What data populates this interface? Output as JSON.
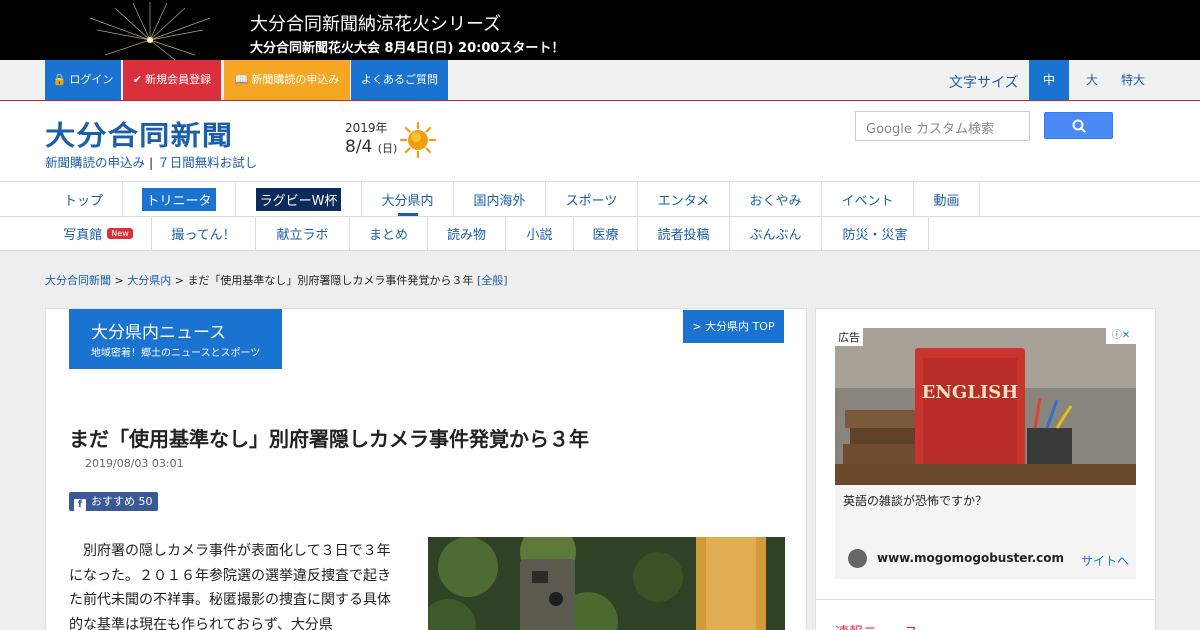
{
  "banner": {
    "title": "大分合同新聞納涼花火シリーズ",
    "subtitle": "大分合同新聞花火大会 8月4日(日) 20:00スタート！"
  },
  "member_bar": {
    "login": "ログイン",
    "register": "新規会員登録",
    "subscribe": "新聞購読の申込み",
    "faq": "よくあるご質問",
    "font_size_label": "文字サイズ",
    "font_sizes": [
      "中",
      "大",
      "特大"
    ],
    "active_font_size": "中",
    "colors": {
      "login": "#1a73d1",
      "register": "#d9303b",
      "subscribe": "#f5a623",
      "faq": "#1a73d1"
    }
  },
  "header": {
    "logo": "大分合同新聞",
    "sub_link1": "新聞購読の申込み",
    "sub_link2": "７日間無料お試し",
    "year": "2019年",
    "date": "8/4",
    "weekday": "(日)",
    "weather_icon": "sun-icon",
    "search_placeholder": "Google カスタム検索"
  },
  "nav_primary": [
    "トップ",
    "トリニータ",
    "ラグビーW杯",
    "大分県内",
    "国内海外",
    "スポーツ",
    "エンタメ",
    "おくやみ",
    "イベント",
    "動画"
  ],
  "nav_secondary": [
    "写真館",
    "撮ってん！",
    "献立ラボ",
    "まとめ",
    "読み物",
    "小説",
    "医療",
    "読者投稿",
    "ぶんぶん",
    "防災・災害"
  ],
  "nav_new_badge": "New",
  "breadcrumb": {
    "home": "大分合同新聞",
    "section": "大分県内",
    "current": "まだ「使用基準なし」別府署隠しカメラ事件発覚から３年",
    "full": "[全般]"
  },
  "section": {
    "title": "大分県内ニュース",
    "tagline": "地域密着！郷土のニュースとスポーツ",
    "top_link": "> 大分県内 TOP"
  },
  "article": {
    "title": "まだ「使用基準なし」別府署隠しカメラ事件発覚から３年",
    "date": "2019/08/03 03:01",
    "recommend_label": "おすすめ",
    "recommend_count": "50",
    "body": "　別府署の隠しカメラ事件が表面化して３日で３年になった。２０１６年参院選の選挙違反捜査で起きた前代未聞の不祥事。秘匿撮影の捜査に関する具体的な基準は現在も作られておらず、大分県"
  },
  "ad": {
    "label": "広告",
    "question": "英語の雑談が恐怖ですか？",
    "domain": "www.mogomogobuster.com",
    "site_link": "サイトへ",
    "book_text": "ENGLISH"
  },
  "sidebar": {
    "news_heading": "速報ニュース"
  }
}
